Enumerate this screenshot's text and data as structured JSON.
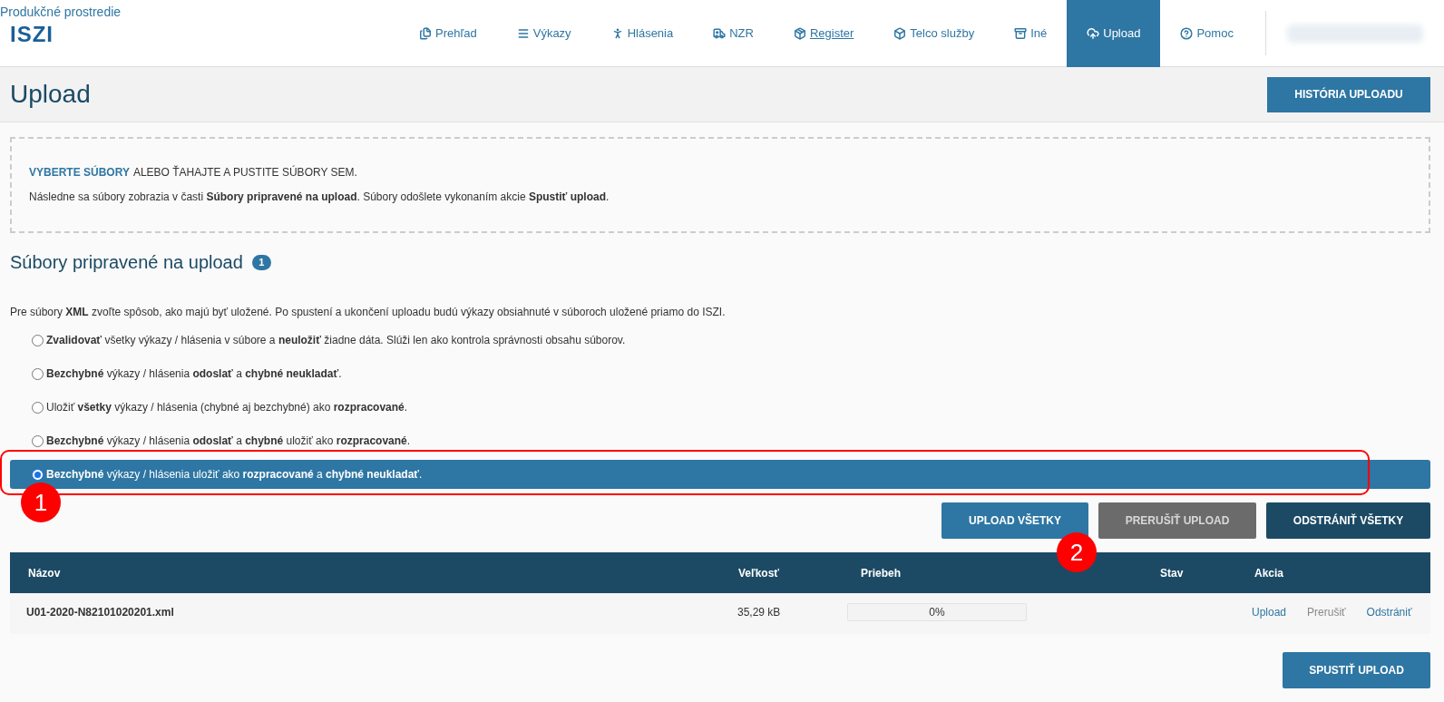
{
  "header": {
    "environment": "Produkčné prostredie",
    "logo": "ISZI",
    "nav": [
      {
        "kind": "files",
        "label": "Prehľad",
        "selected": false,
        "underlined": false
      },
      {
        "kind": "list",
        "label": "Výkazy",
        "selected": false,
        "underlined": false
      },
      {
        "kind": "person",
        "label": "Hlásenia",
        "selected": false,
        "underlined": false
      },
      {
        "kind": "ambulance",
        "label": "NZR",
        "selected": false,
        "underlined": false
      },
      {
        "kind": "package",
        "label": "Register",
        "selected": false,
        "underlined": true
      },
      {
        "kind": "box",
        "label": "Telco služby",
        "selected": false,
        "underlined": false
      },
      {
        "kind": "archive",
        "label": "Iné",
        "selected": false,
        "underlined": false
      },
      {
        "kind": "upload",
        "label": "Upload",
        "selected": true,
        "underlined": false
      },
      {
        "kind": "help",
        "label": "Pomoc",
        "selected": false,
        "underlined": false
      }
    ]
  },
  "page": {
    "title": "Upload",
    "history_button": "HISTÓRIA UPLOADU"
  },
  "dropzone": {
    "link": "VYBERTE SÚBORY",
    "text": "ALEBO ŤAHAJTE A PUSTITE SÚBORY SEM.",
    "note": "Následne sa súbory zobrazia v časti **Súbory pripravené na upload**. Súbory odošlete vykonaním akcie **Spustiť upload**."
  },
  "section": {
    "title": "Súbory pripravené na upload",
    "count": "1",
    "intro": "Pre súbory **XML** zvoľte spôsob, ako majú byť uložené. Po spustení a ukončení uploadu budú výkazy obsiahnuté v súboroch uložené priamo do ISZI.",
    "options": [
      {
        "label": "**Zvalidovať** všetky výkazy / hlásenia v súbore a **neuložiť** žiadne dáta. Slúži len ako kontrola správnosti obsahu súborov.",
        "selected": false
      },
      {
        "label": "**Bezchybné** výkazy / hlásenia **odoslať** a **chybné neukladať**.",
        "selected": false
      },
      {
        "label": "Uložiť **všetky** výkazy / hlásenia (chybné aj bezchybné) ako **rozpracované**.",
        "selected": false
      },
      {
        "label": "**Bezchybné** výkazy / hlásenia **odoslať** a **chybné** uložiť ako **rozpracované**.",
        "selected": false
      },
      {
        "label": "**Bezchybné** výkazy / hlásenia uložiť ako **rozpracované** a **chybné neukladať**.",
        "selected": true
      }
    ]
  },
  "buttons": [
    {
      "label": "UPLOAD VŠETKY",
      "kind": "primary"
    },
    {
      "label": "PRERUŠIŤ UPLOAD",
      "kind": "disabled"
    },
    {
      "label": "ODSTRÁNIŤ VŠETKY",
      "kind": "dark"
    }
  ],
  "table": {
    "columns": [
      "Názov",
      "Veľkosť",
      "Priebeh",
      "Stav",
      "Akcia"
    ],
    "rows": [
      {
        "name": "U01-2020-N82101020201.xml",
        "size": "35,29 kB",
        "progress": {
          "level": 0,
          "reading": "0%"
        },
        "actions": [
          {
            "label": "Upload",
            "disabled": false
          },
          {
            "label": "Prerušiť",
            "disabled": true
          },
          {
            "label": "Odstrániť",
            "disabled": false
          }
        ]
      }
    ]
  },
  "start_button": "SPUSTIŤ UPLOAD",
  "annotations": [
    "1",
    "2"
  ]
}
